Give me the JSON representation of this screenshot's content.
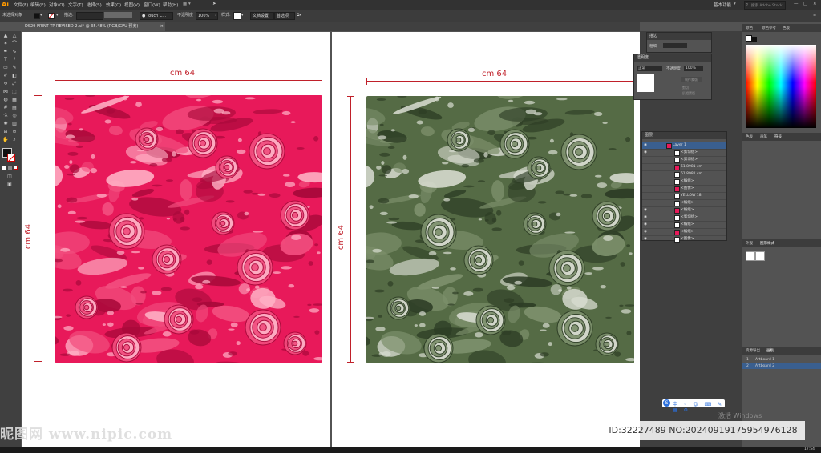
{
  "app": {
    "logo": "Ai"
  },
  "menu": [
    "文件(F)",
    "编辑(E)",
    "对象(O)",
    "文字(T)",
    "选择(S)",
    "效果(C)",
    "视图(V)",
    "窗口(W)",
    "帮助(H)"
  ],
  "top_right": {
    "workspace": "基本功能",
    "search_placeholder": "搜索 Adobe Stock"
  },
  "controlbar": {
    "selection": "未选择对象",
    "stroke_label": "描边:",
    "brush": "Touch C...",
    "opacity_label": "不透明度",
    "opacity_value": "100%",
    "style_label": "样式:",
    "doc_setup": "文档设置",
    "preferences": "首选项"
  },
  "tab": {
    "title": "DS29 PRINT TP  REVISED 2.ai* @ 35.48% (RGB/GPU 预览)",
    "close": "×"
  },
  "artboards": [
    {
      "width_label": "cm 64",
      "height_label": "cm 64",
      "colors": {
        "base": "#e8195a",
        "mid": "#f24d7e",
        "light": "#ffb3c7",
        "dark": "#a8093a"
      }
    },
    {
      "width_label": "cm 64",
      "height_label": "cm 64",
      "colors": {
        "base": "#556b45",
        "mid": "#7c8f6b",
        "light": "#d9ddd2",
        "dark": "#2d3d25"
      }
    }
  ],
  "panels": {
    "stroke": {
      "title": "描边",
      "weight_label": "粗细:"
    },
    "transparency": {
      "title": "透明度",
      "mode": "正常",
      "opacity_label": "不透明度:",
      "opacity_value": "100%",
      "make_mask": "制作蒙版",
      "clip": "剪切",
      "invert": "反相蒙版"
    },
    "color": {
      "tabs": [
        "颜色",
        "颜色参考",
        "色板"
      ]
    },
    "swatch_tabs": [
      "色板",
      "画笔",
      "符号"
    ],
    "appearance_tabs": [
      "外观",
      "图形样式"
    ],
    "artboard_tabs": [
      "资源导出",
      "画板"
    ],
    "artboards_list": [
      "Artboard 1",
      "Artboard 2"
    ],
    "layers": {
      "tabs": [
        "图层"
      ],
      "rows": [
        "Layer 1",
        "<剪切组>",
        "<剪切组>",
        "61.8981 cm",
        "61.8981 cm",
        "<编组>",
        "<图像>",
        "YELLOW 18",
        "<编组>",
        "<编组>",
        "<剪切组>",
        "<编组>",
        "<编组>",
        "<图像>"
      ]
    }
  },
  "overlay": {
    "id_text": "ID:32227489 NO:20240919175954976128",
    "site_text": "昵图网 www.nipic.com",
    "win_activate": "激活 Windows",
    "clock": "17:54"
  }
}
